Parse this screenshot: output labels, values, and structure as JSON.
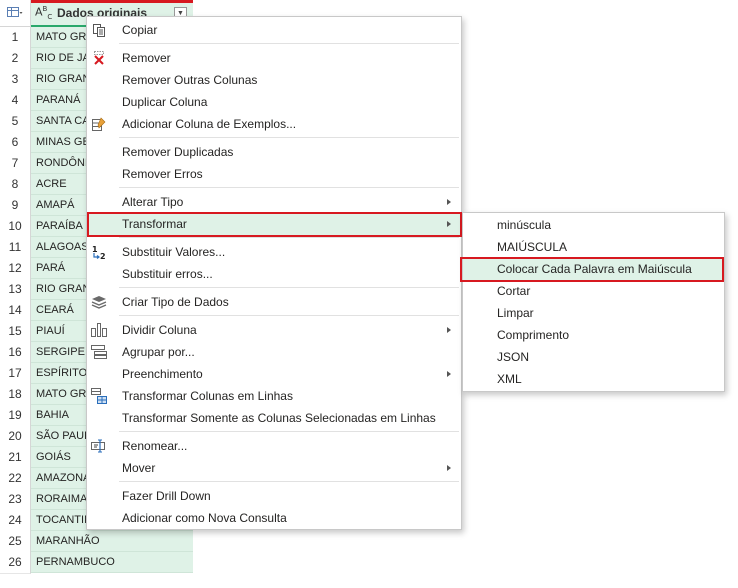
{
  "grid": {
    "column_type_icon": "ABC-text-type-icon",
    "column_title": "Dados originais",
    "rows": [
      {
        "n": "1",
        "v": "MATO GROSSO"
      },
      {
        "n": "2",
        "v": "RIO DE JANEIRO"
      },
      {
        "n": "3",
        "v": "RIO GRANDE DO NORTE"
      },
      {
        "n": "4",
        "v": "PARANÁ"
      },
      {
        "n": "5",
        "v": "SANTA CATARINA"
      },
      {
        "n": "6",
        "v": "MINAS GERAIS"
      },
      {
        "n": "7",
        "v": "RONDÔNIA"
      },
      {
        "n": "8",
        "v": "ACRE"
      },
      {
        "n": "9",
        "v": "AMAPÁ"
      },
      {
        "n": "10",
        "v": "PARAÍBA"
      },
      {
        "n": "11",
        "v": "ALAGOAS"
      },
      {
        "n": "12",
        "v": "PARÁ"
      },
      {
        "n": "13",
        "v": "RIO GRANDE DO SUL"
      },
      {
        "n": "14",
        "v": "CEARÁ"
      },
      {
        "n": "15",
        "v": "PIAUÍ"
      },
      {
        "n": "16",
        "v": "SERGIPE"
      },
      {
        "n": "17",
        "v": "ESPÍRITO SANTO"
      },
      {
        "n": "18",
        "v": "MATO GROSSO DO SUL"
      },
      {
        "n": "19",
        "v": "BAHIA"
      },
      {
        "n": "20",
        "v": "SÃO PAULO"
      },
      {
        "n": "21",
        "v": "GOIÁS"
      },
      {
        "n": "22",
        "v": "AMAZONAS"
      },
      {
        "n": "23",
        "v": "RORAIMA"
      },
      {
        "n": "24",
        "v": "TOCANTINS"
      },
      {
        "n": "25",
        "v": "MARANHÃO"
      },
      {
        "n": "26",
        "v": "PERNAMBUCO"
      }
    ]
  },
  "context_menu": {
    "items": [
      {
        "label": "Copiar",
        "icon": "copy-icon"
      },
      {
        "label": "Remover",
        "icon": "remove-icon"
      },
      {
        "label": "Remover Outras Colunas",
        "icon": ""
      },
      {
        "label": "Duplicar Coluna",
        "icon": ""
      },
      {
        "label": "Adicionar Coluna de Exemplos...",
        "icon": "column-from-examples-icon"
      },
      {
        "label": "Remover Duplicadas",
        "icon": ""
      },
      {
        "label": "Remover Erros",
        "icon": ""
      },
      {
        "label": "Alterar Tipo",
        "icon": "",
        "submenu": true
      },
      {
        "label": "Transformar",
        "icon": "",
        "submenu": true,
        "highlighted": true
      },
      {
        "label": "Substituir Valores...",
        "icon": "replace-values-icon"
      },
      {
        "label": "Substituir erros...",
        "icon": ""
      },
      {
        "label": "Criar Tipo de Dados",
        "icon": "data-type-icon"
      },
      {
        "label": "Dividir Coluna",
        "icon": "split-column-icon",
        "submenu": true
      },
      {
        "label": "Agrupar por...",
        "icon": "group-by-icon"
      },
      {
        "label": "Preenchimento",
        "icon": "",
        "submenu": true
      },
      {
        "label": "Transformar Colunas em Linhas",
        "icon": "unpivot-icon"
      },
      {
        "label": "Transformar Somente as Colunas Selecionadas em Linhas",
        "icon": ""
      },
      {
        "label": "Renomear...",
        "icon": "rename-icon"
      },
      {
        "label": "Mover",
        "icon": "",
        "submenu": true
      },
      {
        "label": "Fazer Drill Down",
        "icon": ""
      },
      {
        "label": "Adicionar como Nova Consulta",
        "icon": ""
      }
    ]
  },
  "transform_submenu": {
    "items": [
      {
        "label": "minúscula"
      },
      {
        "label": "MAIÚSCULA"
      },
      {
        "label": "Colocar Cada Palavra em Maiúscula",
        "highlighted": true
      },
      {
        "label": "Cortar"
      },
      {
        "label": "Limpar"
      },
      {
        "label": "Comprimento"
      },
      {
        "label": "JSON"
      },
      {
        "label": "XML"
      }
    ]
  },
  "colors": {
    "accent_green": "#dff2e7",
    "highlight_red": "#d71920",
    "column_underline": "#2aa86b"
  }
}
